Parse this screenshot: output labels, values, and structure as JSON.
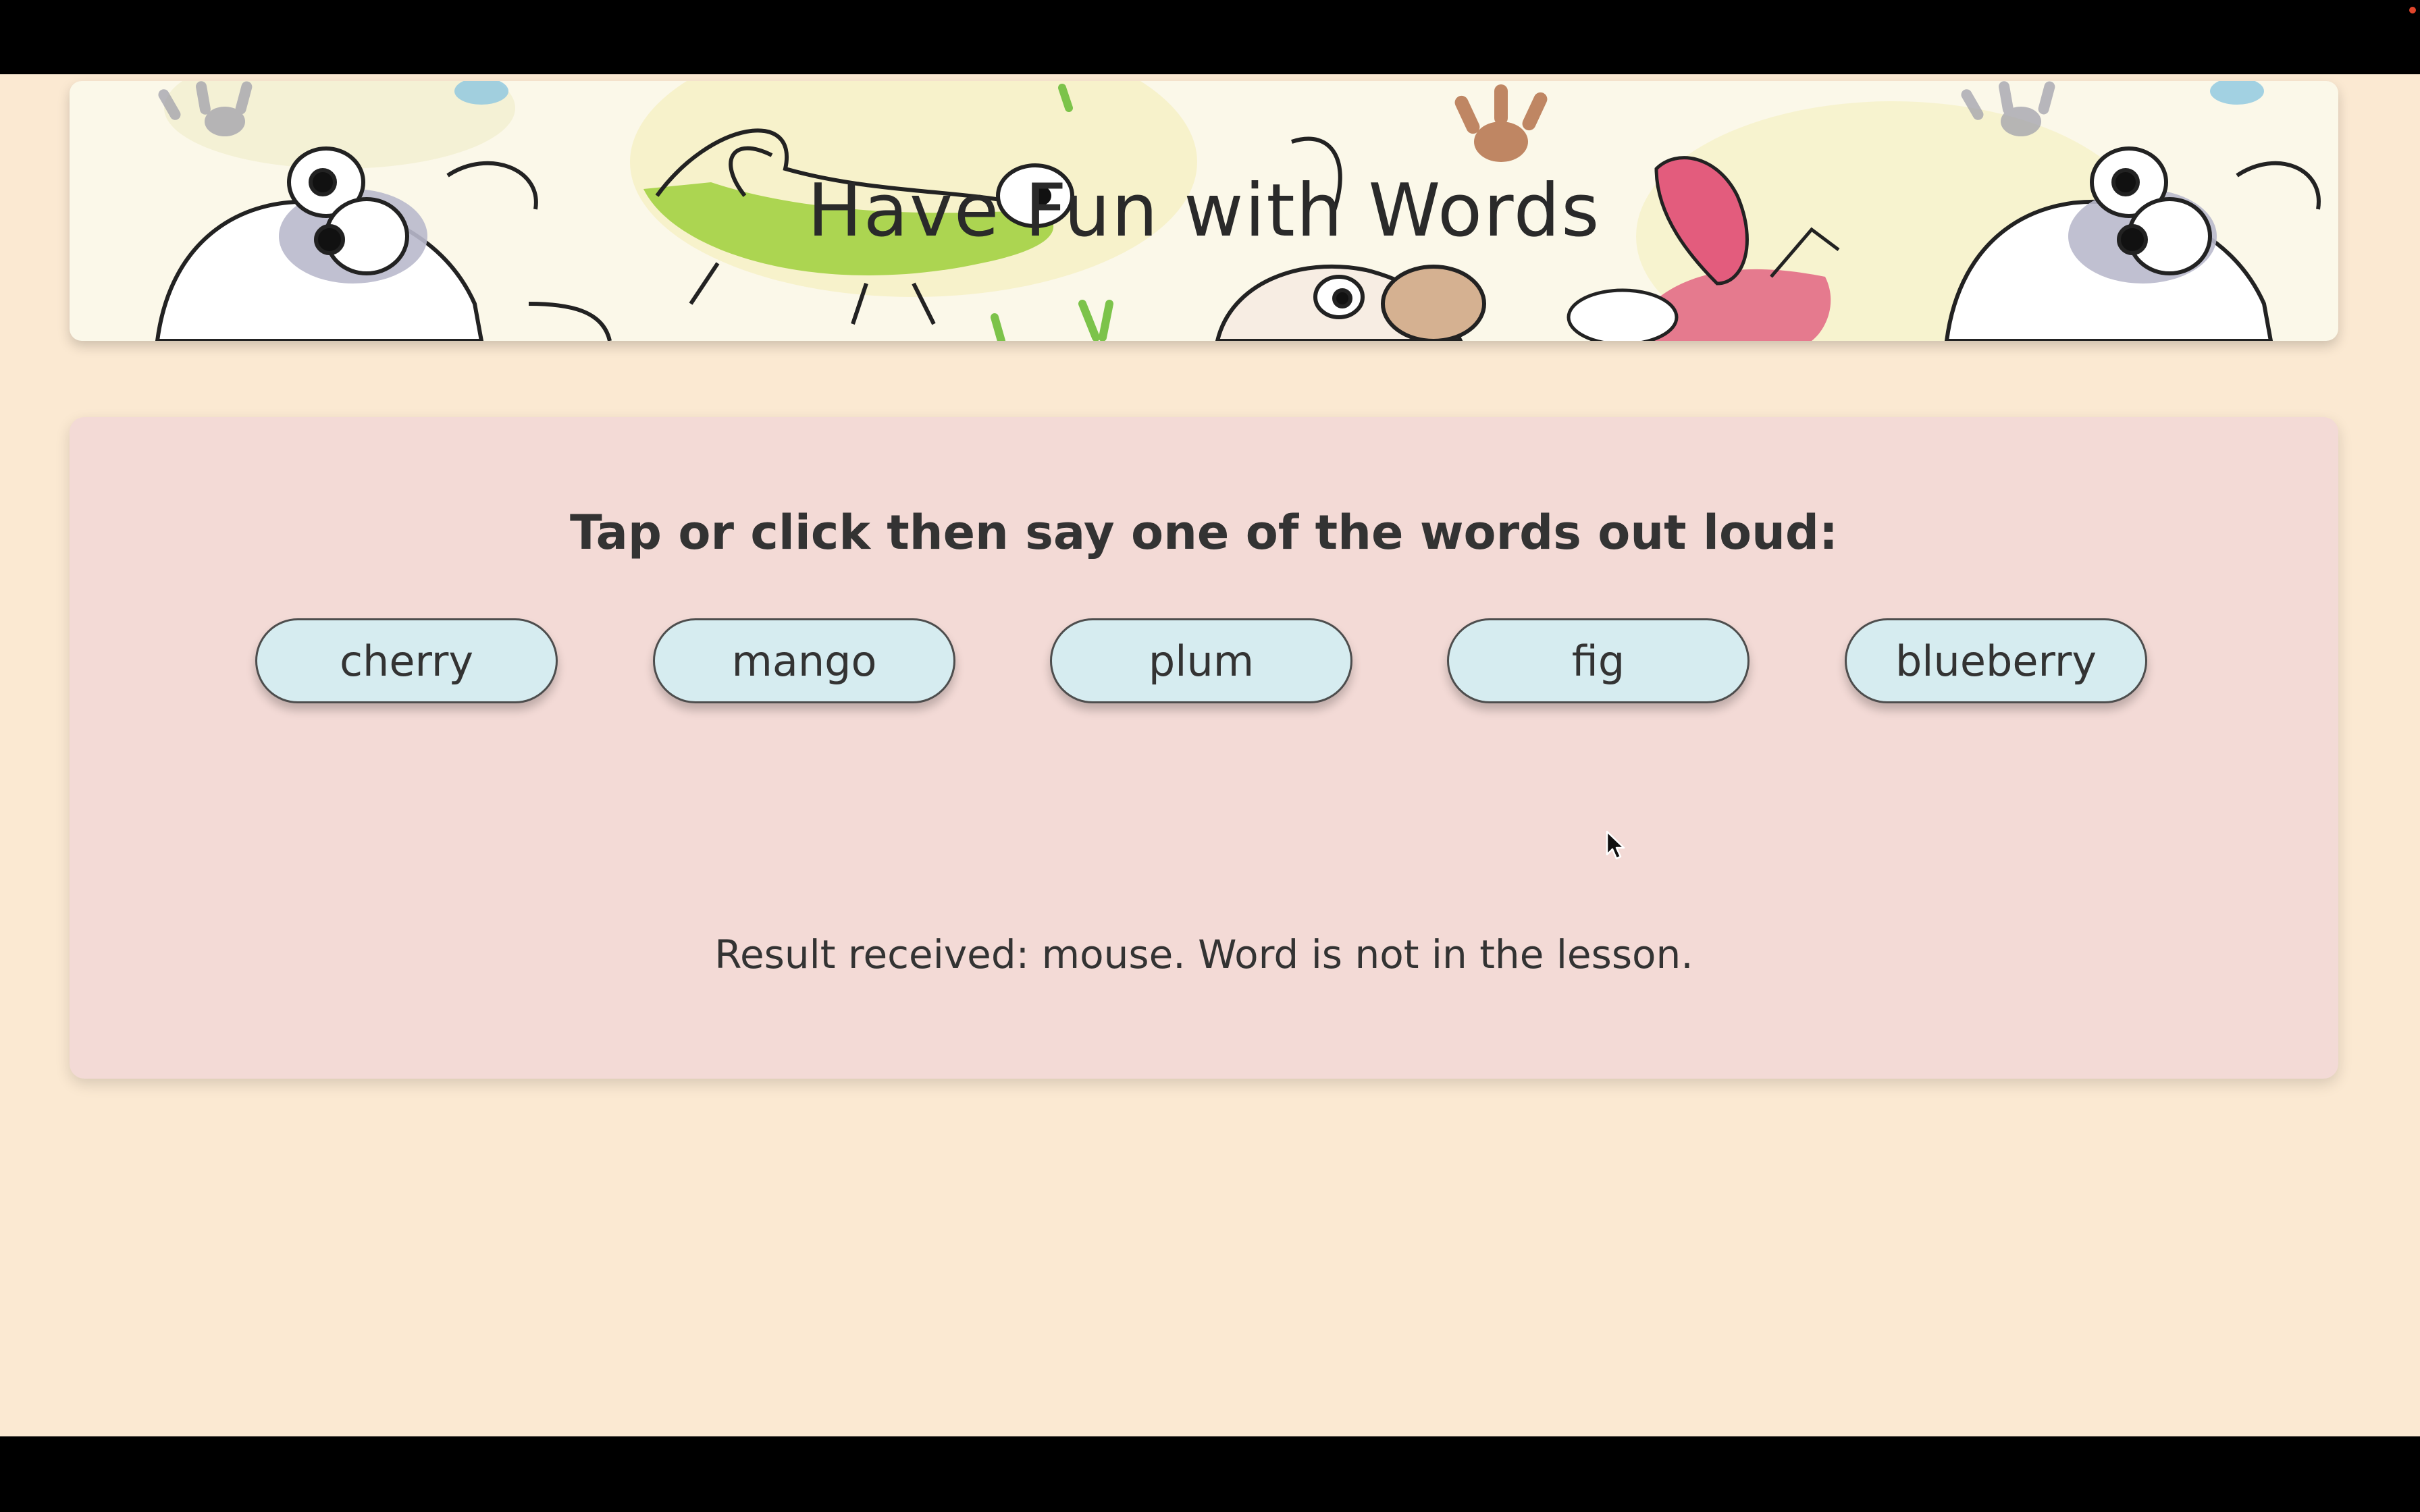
{
  "banner": {
    "title": "Have Fun with Words"
  },
  "lesson": {
    "prompt": "Tap or click then say one of the words out loud:",
    "words": [
      "cherry",
      "mango",
      "plum",
      "fig",
      "blueberry"
    ],
    "result": "Result received: mouse. Word is not in the lesson."
  },
  "colors": {
    "page_background": "#fbe9d2",
    "card_background": "#f3dad6",
    "button_background": "#d6ecf0",
    "text": "#333333"
  },
  "icons": {
    "cursor": "mouse-pointer-icon"
  }
}
